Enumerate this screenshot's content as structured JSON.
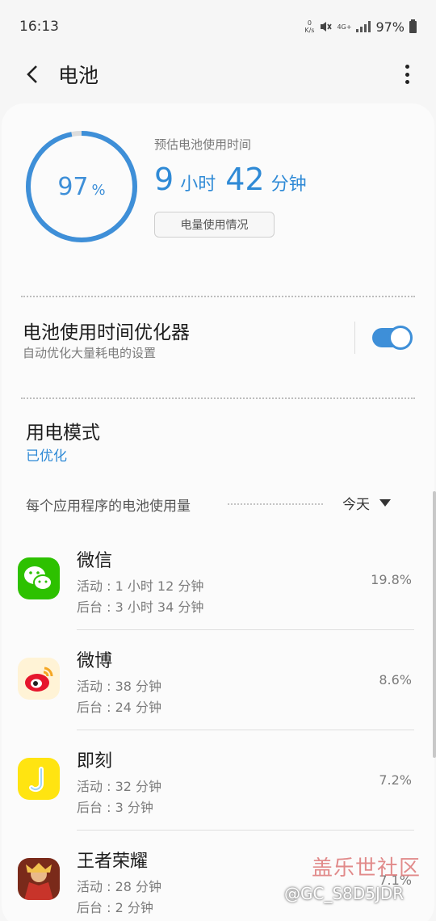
{
  "status_bar": {
    "time": "16:13",
    "net_speed_top": "0",
    "net_speed_bottom": "K/s",
    "net_type": "4G+",
    "battery": "97%"
  },
  "appbar": {
    "title": "电池"
  },
  "battery": {
    "level_value": "97",
    "level_unit": "%",
    "level_fraction": 0.97,
    "estimate_label": "预估电池使用时间",
    "hours": "9",
    "hours_unit": "小时",
    "minutes": "42",
    "minutes_unit": "分钟",
    "usage_button": "电量使用情况"
  },
  "optimizer": {
    "title": "电池使用时间优化器",
    "subtitle": "自动优化大量耗电的设置",
    "enabled": true
  },
  "power_mode": {
    "title": "用电模式",
    "value": "已优化"
  },
  "app_usage": {
    "header": "每个应用程序的电池使用量",
    "range": "今天",
    "apps": [
      {
        "name": "微信",
        "active": "活动 : 1 小时 12 分钟",
        "background": "后台 : 3 小时 34 分钟",
        "percent": "19.8%",
        "icon": "wechat-icon"
      },
      {
        "name": "微博",
        "active": "活动 : 38 分钟",
        "background": "后台 : 24 分钟",
        "percent": "8.6%",
        "icon": "weibo-icon"
      },
      {
        "name": "即刻",
        "active": "活动 : 32 分钟",
        "background": "后台 : 3 分钟",
        "percent": "7.2%",
        "icon": "jike-icon"
      },
      {
        "name": "王者荣耀",
        "active": "活动 : 28 分钟",
        "background": "后台 : 2 分钟",
        "percent": "7.1%",
        "icon": "honor-of-kings-icon"
      }
    ]
  },
  "watermark": {
    "line1": "盖乐世社区",
    "line2": "@GC_S8D5JDR"
  },
  "colors": {
    "accent": "#3e8fd8",
    "wechat": "#2dc100",
    "weibo_bg": "#fff3d6",
    "jike": "#ffe411"
  }
}
